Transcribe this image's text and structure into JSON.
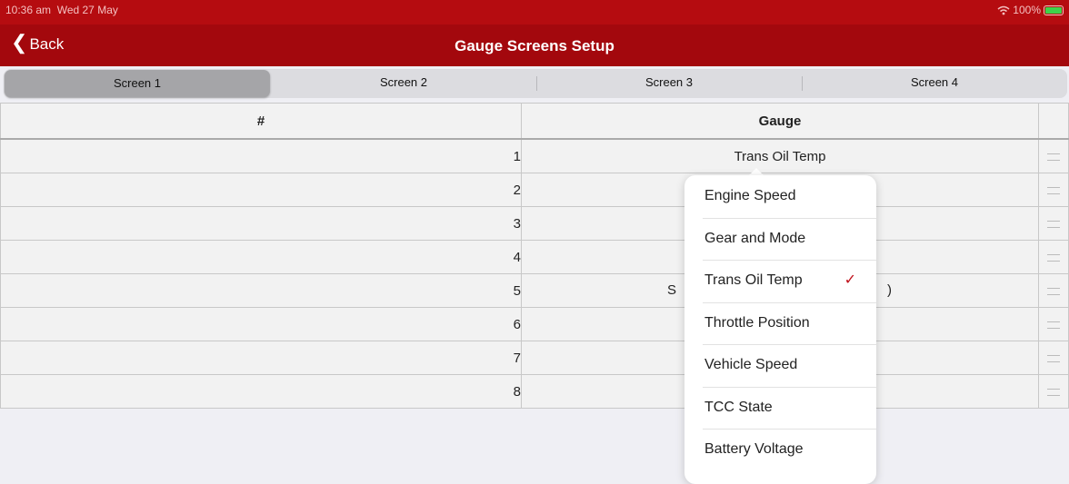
{
  "status": {
    "time": "10:36 am",
    "date": "Wed 27 May",
    "wifi_icon": "wifi-icon",
    "battery": "100%",
    "battery_level": 1.0
  },
  "nav": {
    "back_label": "Back",
    "title": "Gauge Screens Setup"
  },
  "tabs": [
    {
      "label": "Screen 1",
      "selected": true
    },
    {
      "label": "Screen 2",
      "selected": false
    },
    {
      "label": "Screen 3",
      "selected": false
    },
    {
      "label": "Screen 4",
      "selected": false
    }
  ],
  "table": {
    "headers": [
      "#",
      "Gauge"
    ],
    "rows": [
      {
        "num": "1",
        "gauge": "Trans Oil Temp"
      },
      {
        "num": "2",
        "gauge": ""
      },
      {
        "num": "3",
        "gauge": ""
      },
      {
        "num": "4",
        "gauge": ""
      },
      {
        "num": "5",
        "gauge": ""
      },
      {
        "num": "6",
        "gauge": ""
      },
      {
        "num": "7",
        "gauge": ""
      },
      {
        "num": "8",
        "gauge": ""
      }
    ],
    "row5_left_fragment": "S",
    "row5_right_fragment": ")"
  },
  "dropdown": {
    "options": [
      {
        "label": "Engine Speed",
        "checked": false
      },
      {
        "label": "Gear and Mode",
        "checked": false
      },
      {
        "label": "Trans Oil Temp",
        "checked": true
      },
      {
        "label": "Throttle Position",
        "checked": false
      },
      {
        "label": "Vehicle Speed",
        "checked": false
      },
      {
        "label": "TCC State",
        "checked": false
      },
      {
        "label": "Battery Voltage",
        "checked": false
      }
    ],
    "check_mark": "✓",
    "accent": "#c0101a"
  },
  "colors": {
    "status_bar": "#b50c10",
    "nav_bar": "#a3080d"
  }
}
